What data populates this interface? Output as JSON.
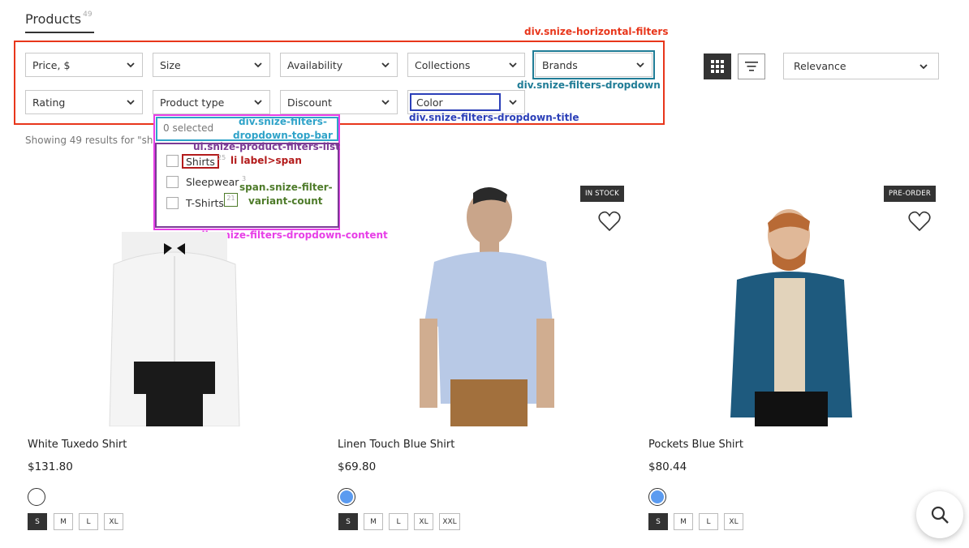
{
  "header": {
    "tab_label": "Products",
    "tab_count": "49"
  },
  "filters": {
    "row1": [
      "Price, $",
      "Size",
      "Availability",
      "Collections",
      "Brands"
    ],
    "row2": [
      "Rating",
      "Product type",
      "Discount",
      "Color"
    ]
  },
  "sort": {
    "selected": "Relevance"
  },
  "showing_text": "Showing 49 results for \"shi",
  "dropdown": {
    "selected_text": "0 selected",
    "options": [
      {
        "label": "Shirts",
        "count": "25"
      },
      {
        "label": "Sleepwear",
        "count": "3"
      },
      {
        "label": "T-Shirts",
        "count": "21"
      }
    ]
  },
  "annotations": {
    "horizontal_filters": "div.snize-horizontal-filters",
    "filters_dropdown": "div.snize-filters-dropdown",
    "filters_dropdown_title": "div.snize-filters-dropdown-title",
    "top_bar_1": "div.snize-filters-",
    "top_bar_2": "dropdown-top-bar",
    "filters_list": "ul.snize-product-filters-list",
    "li_label": "li label>span",
    "variant_count_1": "span.snize-filter-",
    "variant_count_2": "variant-count",
    "dropdown_content": "div.snize-filters-dropdown-content"
  },
  "products": [
    {
      "name": "White Tuxedo Shirt",
      "price": "$131.80",
      "badge": "",
      "swatch": "#ffffff",
      "sizes": [
        "S",
        "M",
        "L",
        "XL"
      ]
    },
    {
      "name": "Linen Touch Blue Shirt",
      "price": "$69.80",
      "badge": "IN STOCK",
      "swatch": "#5b9bf0",
      "sizes": [
        "S",
        "M",
        "L",
        "XL",
        "XXL"
      ]
    },
    {
      "name": "Pockets Blue Shirt",
      "price": "$80.44",
      "badge": "PRE-ORDER",
      "swatch": "#5b9bf0",
      "sizes": [
        "S",
        "M",
        "L",
        "XL"
      ]
    }
  ],
  "colors": {
    "annotation_red": "#e8361b",
    "annotation_teal": "#1f7c96",
    "annotation_blue": "#2b3fb8",
    "annotation_purple": "#7b3b95",
    "annotation_magenta": "#e73ee7",
    "annotation_green": "#4e7b2a",
    "annotation_darkred": "#b31b1b"
  },
  "icons": {
    "search_fab": "search-icon",
    "grid_view": "grid-icon",
    "list_view": "filter-lines-icon",
    "wishlist": "heart-icon"
  }
}
